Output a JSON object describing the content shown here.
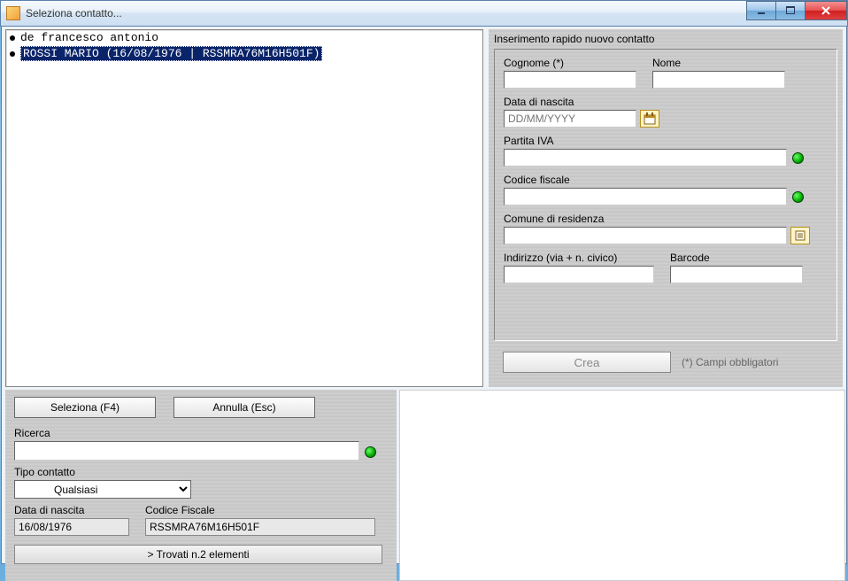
{
  "window": {
    "title": "Seleziona contatto..."
  },
  "contact_list": {
    "items": [
      {
        "text": "de francesco antonio",
        "selected": false
      },
      {
        "text": "ROSSI MARIO (16/08/1976 | RSSMRA76M16H501F)",
        "selected": true
      }
    ]
  },
  "right_form": {
    "title": "Inserimento rapido nuovo contatto",
    "labels": {
      "cognome": "Cognome (*)",
      "nome": "Nome",
      "data_nascita": "Data di nascita",
      "data_nascita_placeholder": "DD/MM/YYYY",
      "partita_iva": "Partita IVA",
      "codice_fiscale": "Codice fiscale",
      "comune": "Comune di residenza",
      "indirizzo": "Indirizzo (via + n. civico)",
      "barcode": "Barcode"
    },
    "crea_label": "Crea",
    "required_note": "(*) Campi obbligatori"
  },
  "bottom_left": {
    "btn_seleziona": "Seleziona (F4)",
    "btn_annulla": "Annulla (Esc)",
    "ricerca_label": "Ricerca",
    "tipo_contatto_label": "Tipo contatto",
    "tipo_contatto_value": "Qualsiasi",
    "data_nascita_label": "Data di nascita",
    "data_nascita_value": "16/08/1976",
    "codice_fiscale_label": "Codice Fiscale",
    "codice_fiscale_value": "RSSMRA76M16H501F",
    "status": "> Trovati n.2 elementi"
  }
}
